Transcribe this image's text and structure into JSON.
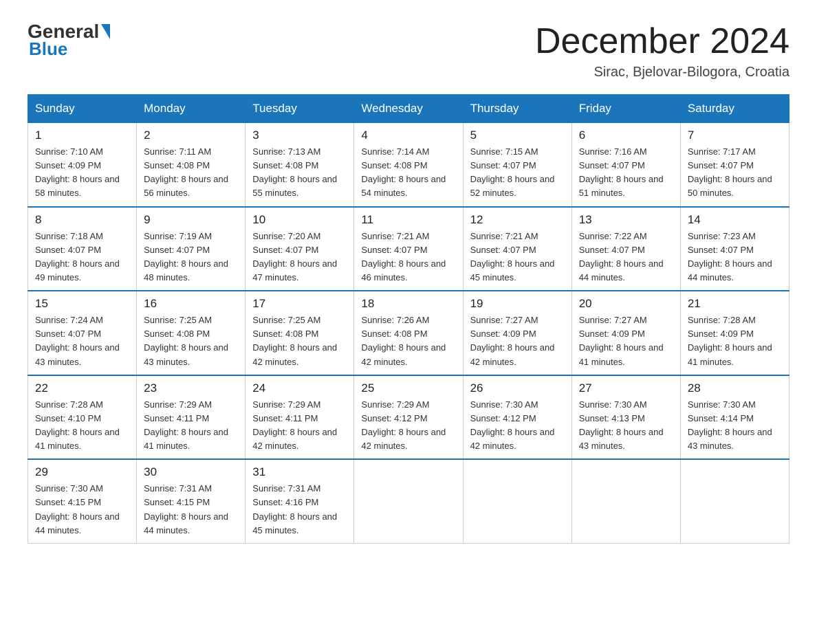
{
  "header": {
    "logo_general": "General",
    "logo_blue": "Blue",
    "month_title": "December 2024",
    "location": "Sirac, Bjelovar-Bilogora, Croatia"
  },
  "calendar": {
    "days": [
      "Sunday",
      "Monday",
      "Tuesday",
      "Wednesday",
      "Thursday",
      "Friday",
      "Saturday"
    ],
    "weeks": [
      [
        {
          "num": "1",
          "sunrise": "7:10 AM",
          "sunset": "4:09 PM",
          "daylight": "8 hours and 58 minutes."
        },
        {
          "num": "2",
          "sunrise": "7:11 AM",
          "sunset": "4:08 PM",
          "daylight": "8 hours and 56 minutes."
        },
        {
          "num": "3",
          "sunrise": "7:13 AM",
          "sunset": "4:08 PM",
          "daylight": "8 hours and 55 minutes."
        },
        {
          "num": "4",
          "sunrise": "7:14 AM",
          "sunset": "4:08 PM",
          "daylight": "8 hours and 54 minutes."
        },
        {
          "num": "5",
          "sunrise": "7:15 AM",
          "sunset": "4:07 PM",
          "daylight": "8 hours and 52 minutes."
        },
        {
          "num": "6",
          "sunrise": "7:16 AM",
          "sunset": "4:07 PM",
          "daylight": "8 hours and 51 minutes."
        },
        {
          "num": "7",
          "sunrise": "7:17 AM",
          "sunset": "4:07 PM",
          "daylight": "8 hours and 50 minutes."
        }
      ],
      [
        {
          "num": "8",
          "sunrise": "7:18 AM",
          "sunset": "4:07 PM",
          "daylight": "8 hours and 49 minutes."
        },
        {
          "num": "9",
          "sunrise": "7:19 AM",
          "sunset": "4:07 PM",
          "daylight": "8 hours and 48 minutes."
        },
        {
          "num": "10",
          "sunrise": "7:20 AM",
          "sunset": "4:07 PM",
          "daylight": "8 hours and 47 minutes."
        },
        {
          "num": "11",
          "sunrise": "7:21 AM",
          "sunset": "4:07 PM",
          "daylight": "8 hours and 46 minutes."
        },
        {
          "num": "12",
          "sunrise": "7:21 AM",
          "sunset": "4:07 PM",
          "daylight": "8 hours and 45 minutes."
        },
        {
          "num": "13",
          "sunrise": "7:22 AM",
          "sunset": "4:07 PM",
          "daylight": "8 hours and 44 minutes."
        },
        {
          "num": "14",
          "sunrise": "7:23 AM",
          "sunset": "4:07 PM",
          "daylight": "8 hours and 44 minutes."
        }
      ],
      [
        {
          "num": "15",
          "sunrise": "7:24 AM",
          "sunset": "4:07 PM",
          "daylight": "8 hours and 43 minutes."
        },
        {
          "num": "16",
          "sunrise": "7:25 AM",
          "sunset": "4:08 PM",
          "daylight": "8 hours and 43 minutes."
        },
        {
          "num": "17",
          "sunrise": "7:25 AM",
          "sunset": "4:08 PM",
          "daylight": "8 hours and 42 minutes."
        },
        {
          "num": "18",
          "sunrise": "7:26 AM",
          "sunset": "4:08 PM",
          "daylight": "8 hours and 42 minutes."
        },
        {
          "num": "19",
          "sunrise": "7:27 AM",
          "sunset": "4:09 PM",
          "daylight": "8 hours and 42 minutes."
        },
        {
          "num": "20",
          "sunrise": "7:27 AM",
          "sunset": "4:09 PM",
          "daylight": "8 hours and 41 minutes."
        },
        {
          "num": "21",
          "sunrise": "7:28 AM",
          "sunset": "4:09 PM",
          "daylight": "8 hours and 41 minutes."
        }
      ],
      [
        {
          "num": "22",
          "sunrise": "7:28 AM",
          "sunset": "4:10 PM",
          "daylight": "8 hours and 41 minutes."
        },
        {
          "num": "23",
          "sunrise": "7:29 AM",
          "sunset": "4:11 PM",
          "daylight": "8 hours and 41 minutes."
        },
        {
          "num": "24",
          "sunrise": "7:29 AM",
          "sunset": "4:11 PM",
          "daylight": "8 hours and 42 minutes."
        },
        {
          "num": "25",
          "sunrise": "7:29 AM",
          "sunset": "4:12 PM",
          "daylight": "8 hours and 42 minutes."
        },
        {
          "num": "26",
          "sunrise": "7:30 AM",
          "sunset": "4:12 PM",
          "daylight": "8 hours and 42 minutes."
        },
        {
          "num": "27",
          "sunrise": "7:30 AM",
          "sunset": "4:13 PM",
          "daylight": "8 hours and 43 minutes."
        },
        {
          "num": "28",
          "sunrise": "7:30 AM",
          "sunset": "4:14 PM",
          "daylight": "8 hours and 43 minutes."
        }
      ],
      [
        {
          "num": "29",
          "sunrise": "7:30 AM",
          "sunset": "4:15 PM",
          "daylight": "8 hours and 44 minutes."
        },
        {
          "num": "30",
          "sunrise": "7:31 AM",
          "sunset": "4:15 PM",
          "daylight": "8 hours and 44 minutes."
        },
        {
          "num": "31",
          "sunrise": "7:31 AM",
          "sunset": "4:16 PM",
          "daylight": "8 hours and 45 minutes."
        },
        null,
        null,
        null,
        null
      ]
    ]
  }
}
